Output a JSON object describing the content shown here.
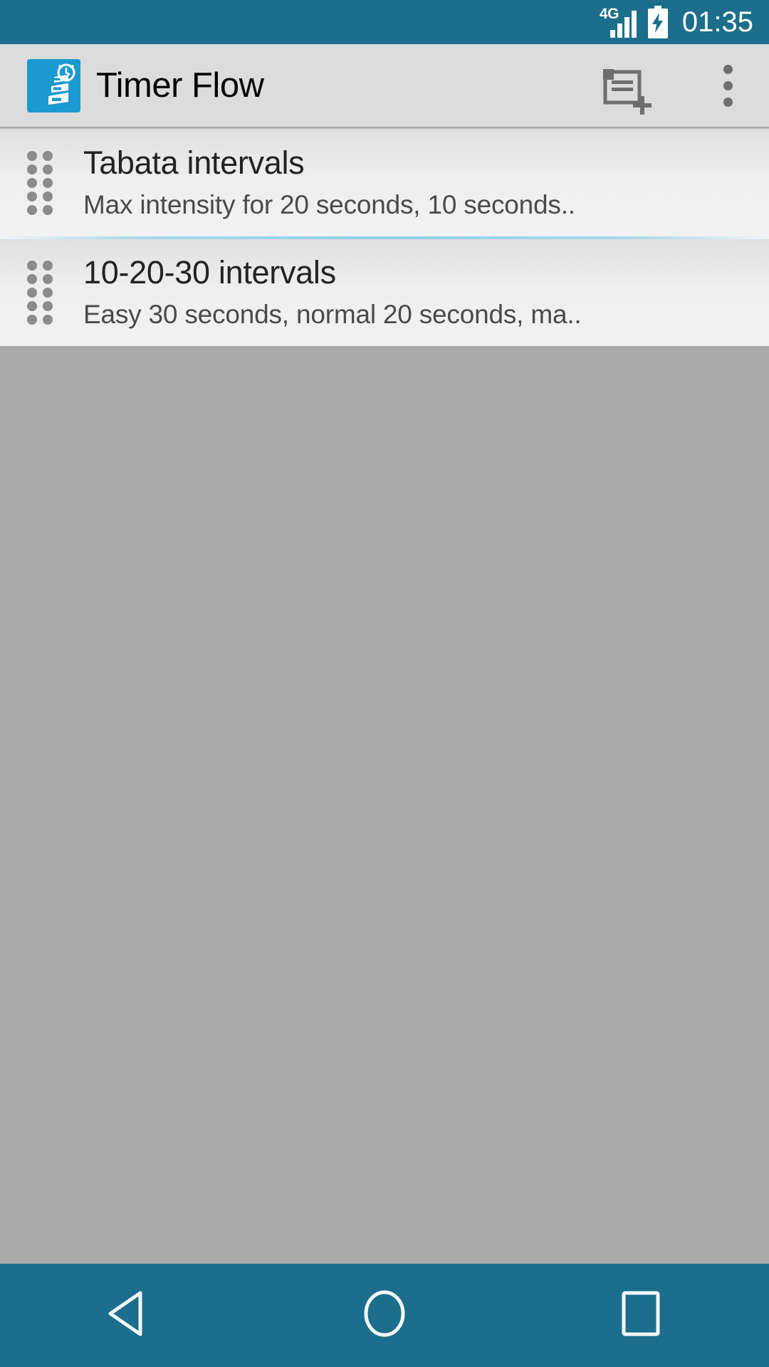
{
  "status_bar": {
    "network_label": "4G",
    "signal_icon": "signal-bars-icon",
    "battery_icon": "battery-charging-icon",
    "time": "01:35",
    "background_color": "#1c6e8c",
    "foreground_color": "#ffffff"
  },
  "app_bar": {
    "app_icon": "timer-flow-app-icon",
    "title": "Timer Flow",
    "background_color": "#dcdcdc",
    "title_color": "#050505",
    "actions": [
      {
        "name": "add-timer-button",
        "icon": "note-add-icon"
      },
      {
        "name": "overflow-menu-button",
        "icon": "more-vert-icon"
      }
    ]
  },
  "list": {
    "divider_color": "#8fd0e8",
    "items": [
      {
        "drag_handle": "drag-handle-icon",
        "title": "Tabata intervals",
        "subtitle": "Max intensity for 20 seconds, 10 seconds.."
      },
      {
        "drag_handle": "drag-handle-icon",
        "title": "10-20-30 intervals",
        "subtitle": "Easy 30 seconds, normal 20 seconds, ma.."
      }
    ]
  },
  "content": {
    "background_color": "#ababab"
  },
  "nav_bar": {
    "background_color": "#1c6e8c",
    "buttons": [
      {
        "name": "nav-back-button",
        "icon": "back-triangle-icon"
      },
      {
        "name": "nav-home-button",
        "icon": "home-circle-icon"
      },
      {
        "name": "nav-recents-button",
        "icon": "recents-square-icon"
      }
    ]
  }
}
